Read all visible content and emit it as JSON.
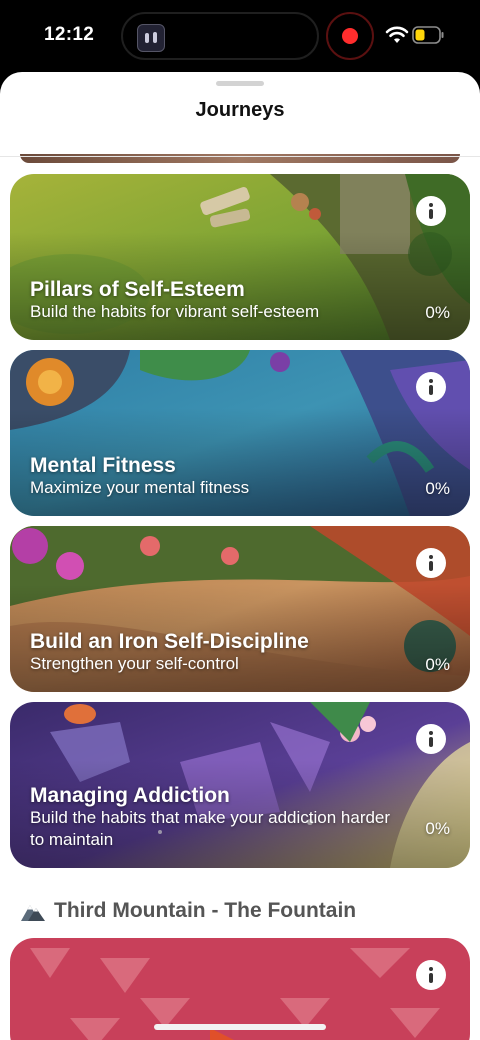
{
  "status_bar": {
    "time": "12:12",
    "recording_color": "#ff2d2d",
    "wifi_icon": "wifi-icon",
    "battery_icon": "battery-icon",
    "battery_color": "#ffd60a"
  },
  "sheet": {
    "title": "Journeys"
  },
  "cards": [
    {
      "title": "Pillars of Self-Esteem",
      "subtitle": "Build the habits for vibrant self-esteem",
      "progress": "0%",
      "info_icon": "info-icon"
    },
    {
      "title": "Mental Fitness",
      "subtitle": "Maximize your mental fitness",
      "progress": "0%",
      "info_icon": "info-icon"
    },
    {
      "title": "Build an Iron Self-Discipline",
      "subtitle": "Strengthen your self-control",
      "progress": "0%",
      "info_icon": "info-icon"
    },
    {
      "title": "Managing Addiction",
      "subtitle": "Build the habits that make your addiction harder to maintain",
      "progress": "0%",
      "info_icon": "info-icon"
    },
    {
      "info_icon": "info-icon"
    }
  ],
  "section": {
    "icon": "mountain-icon",
    "title": "Third Mountain - The Fountain"
  }
}
